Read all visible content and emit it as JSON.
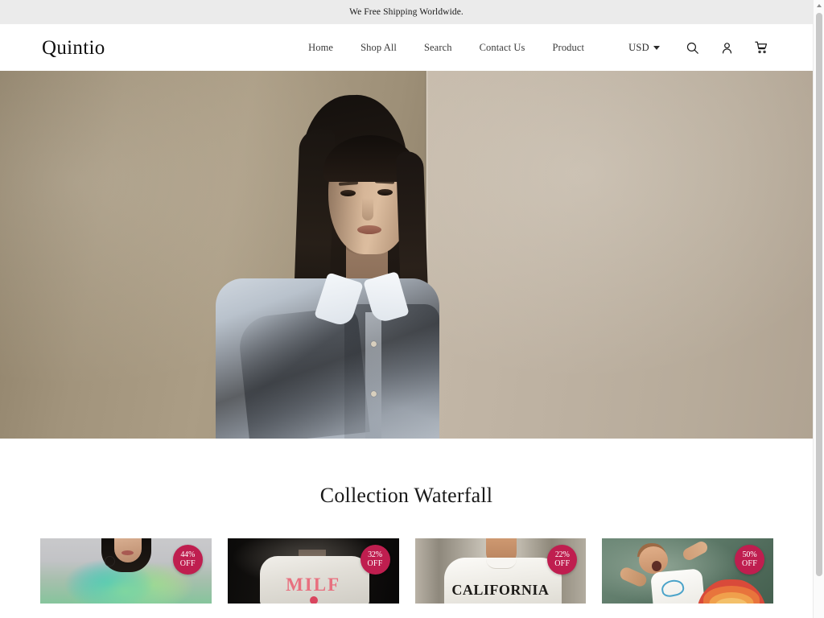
{
  "announcement": {
    "text": "We Free Shipping Worldwide."
  },
  "header": {
    "logo": "Quintio",
    "nav": [
      {
        "label": "Home"
      },
      {
        "label": "Shop All"
      },
      {
        "label": "Search"
      },
      {
        "label": "Contact Us"
      },
      {
        "label": "Product"
      }
    ],
    "currency": {
      "selected": "USD",
      "icon": "chevron-down-icon"
    },
    "icons": [
      {
        "name": "search-icon"
      },
      {
        "name": "account-icon"
      },
      {
        "name": "cart-icon"
      }
    ]
  },
  "hero": {
    "alt": "Model in light blue shirt against taupe backdrop",
    "background_left": "#a2947c",
    "background_right": "#bdb1a1"
  },
  "collection": {
    "title": "Collection Waterfall",
    "badge_color": "#bf1e4f",
    "products": [
      {
        "alt": "Woman in green gradient blouse",
        "discount_pct": "44%",
        "discount_label": "OFF"
      },
      {
        "alt": "White graphic sweatshirt",
        "graphic_text": "MILF",
        "discount_pct": "32%",
        "discount_label": "OFF"
      },
      {
        "alt": "White California sweatshirt",
        "graphic_text": "CALIFORNIA",
        "discount_pct": "22%",
        "discount_label": "OFF"
      },
      {
        "alt": "Baby on green blanket with rainbow toy",
        "discount_pct": "50%",
        "discount_label": "OFF"
      }
    ]
  }
}
